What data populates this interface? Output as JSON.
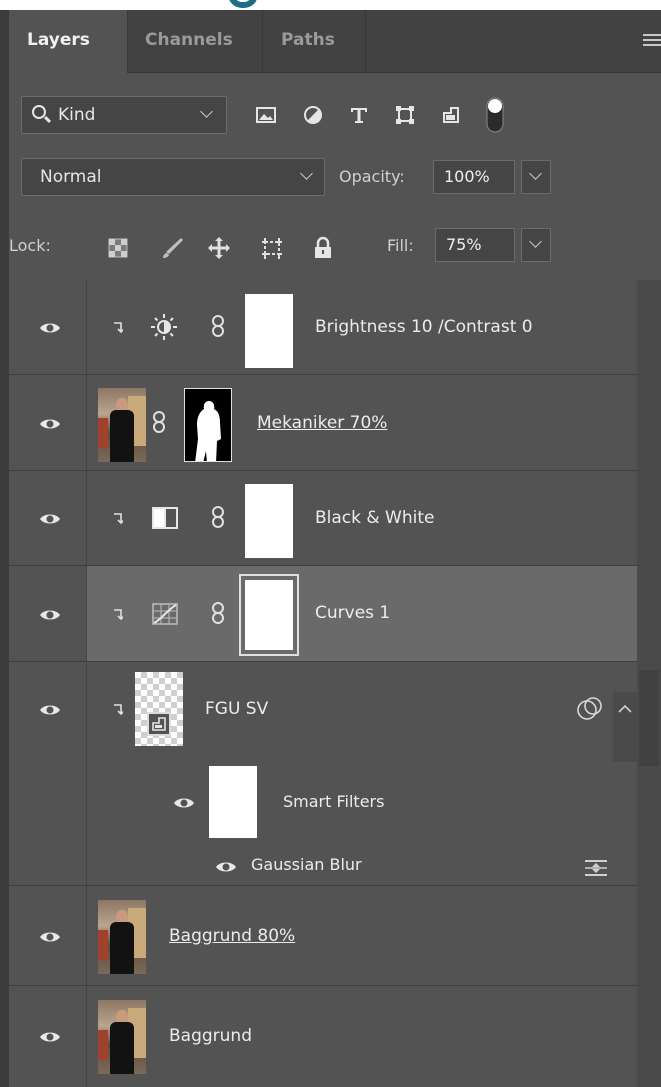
{
  "tabs": [
    {
      "label": "Layers",
      "active": true
    },
    {
      "label": "Channels",
      "active": false
    },
    {
      "label": "Paths",
      "active": false
    }
  ],
  "filter": {
    "kind_label": "Kind",
    "icons": [
      "image-filter-icon",
      "adjustment-filter-icon",
      "type-filter-icon",
      "shape-filter-icon",
      "smart-object-filter-icon",
      "filter-toggle-icon"
    ]
  },
  "blend": {
    "mode": "Normal",
    "opacity_label": "Opacity:",
    "opacity_value": "100%"
  },
  "lock": {
    "label": "Lock:",
    "fill_label": "Fill:",
    "fill_value": "75%"
  },
  "layers": [
    {
      "name": "Brightness  10 /Contrast 0",
      "type": "brightness-contrast",
      "clipped": true,
      "visible": true
    },
    {
      "name": "Mekaniker 70%",
      "type": "pixel-with-mask",
      "clipped": false,
      "visible": true
    },
    {
      "name": "Black & White",
      "type": "black-white",
      "clipped": true,
      "visible": true
    },
    {
      "name": "Curves 1",
      "type": "curves",
      "clipped": true,
      "visible": true,
      "selected": true
    },
    {
      "name": "FGU SV",
      "type": "smart-object",
      "clipped": true,
      "visible": true
    },
    {
      "name": "Smart Filters",
      "type": "smart-filters",
      "visible": true
    },
    {
      "name": "Gaussian Blur",
      "type": "filter",
      "visible": true
    },
    {
      "name": "Baggrund 80%",
      "type": "pixel",
      "clipped": false,
      "visible": true
    },
    {
      "name": "Baggrund",
      "type": "pixel",
      "clipped": false,
      "visible": true
    }
  ],
  "colors": {
    "panel": "#535353",
    "selected": "#6a6a6a",
    "tabbar": "#424242"
  }
}
